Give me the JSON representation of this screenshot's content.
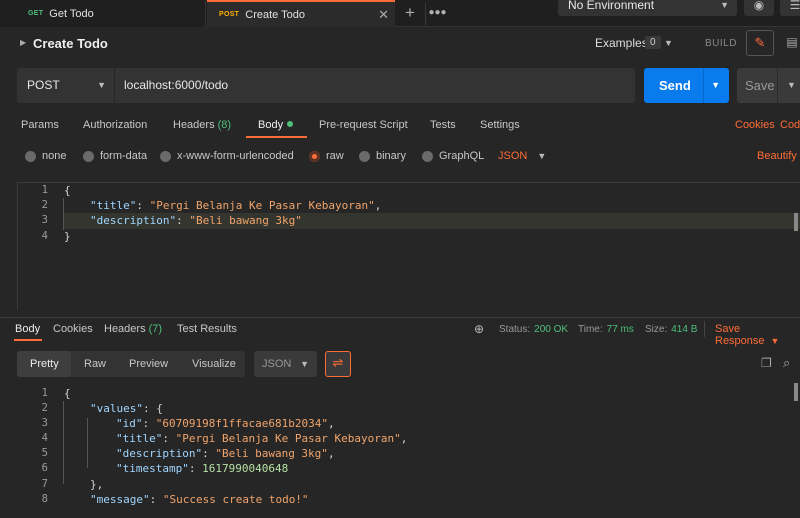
{
  "tabs": [
    {
      "method": "GET",
      "title": "Get Todo"
    },
    {
      "method": "POST",
      "title": "Create Todo",
      "close": "✕"
    }
  ],
  "environment": {
    "selected": "No Environment"
  },
  "request": {
    "title": "Create Todo",
    "examples_label": "Examples",
    "examples_count": "0",
    "build_label": "BUILD",
    "method": "POST",
    "url": "localhost:6000/todo",
    "send_label": "Send",
    "save_label": "Save"
  },
  "request_tabs": {
    "params": "Params",
    "authorization": "Authorization",
    "headers": "Headers",
    "headers_count": "(8)",
    "body": "Body",
    "prerequest": "Pre-request Script",
    "tests": "Tests",
    "settings": "Settings",
    "cookies": "Cookies",
    "code": "Code"
  },
  "body_types": {
    "none": "none",
    "form_data": "form-data",
    "urlencoded": "x-www-form-urlencoded",
    "raw": "raw",
    "binary": "binary",
    "graphql": "GraphQL",
    "format": "JSON",
    "beautify": "Beautify"
  },
  "request_body": {
    "line_numbers": [
      "1",
      "2",
      "3",
      "4"
    ],
    "open": "{",
    "k_title": "\"title\"",
    "v_title": "\"Pergi Belanja Ke Pasar Kebayoran\"",
    "k_description": "\"description\"",
    "v_description": "\"Beli bawang 3kg\"",
    "close": "}"
  },
  "response_tabs": {
    "body": "Body",
    "cookies": "Cookies",
    "headers": "Headers",
    "headers_count": "(7)",
    "test_results": "Test Results"
  },
  "response_status": {
    "status_label": "Status:",
    "status_value": "200 OK",
    "time_label": "Time:",
    "time_value": "77 ms",
    "size_label": "Size:",
    "size_value": "414 B",
    "save_response": "Save Response"
  },
  "response_view": {
    "pretty": "Pretty",
    "raw": "Raw",
    "preview": "Preview",
    "visualize": "Visualize",
    "format": "JSON"
  },
  "response_body": {
    "line_numbers": [
      "1",
      "2",
      "3",
      "4",
      "5",
      "6",
      "7",
      "8"
    ],
    "open": "{",
    "k_values": "\"values\"",
    "k_id": "\"id\"",
    "v_id": "\"60709198f1ffacae681b2034\"",
    "k_title": "\"title\"",
    "v_title": "\"Pergi Belanja Ke Pasar Kebayoran\"",
    "k_description": "\"description\"",
    "v_description": "\"Beli bawang 3kg\"",
    "k_timestamp": "\"timestamp\"",
    "v_timestamp": "1617990040648",
    "close_values": "},",
    "k_message": "\"message\"",
    "v_message": "\"Success create todo!\""
  },
  "colors": {
    "accent": "#ff6c37",
    "send": "#097bed",
    "success": "#4fbf7a"
  }
}
